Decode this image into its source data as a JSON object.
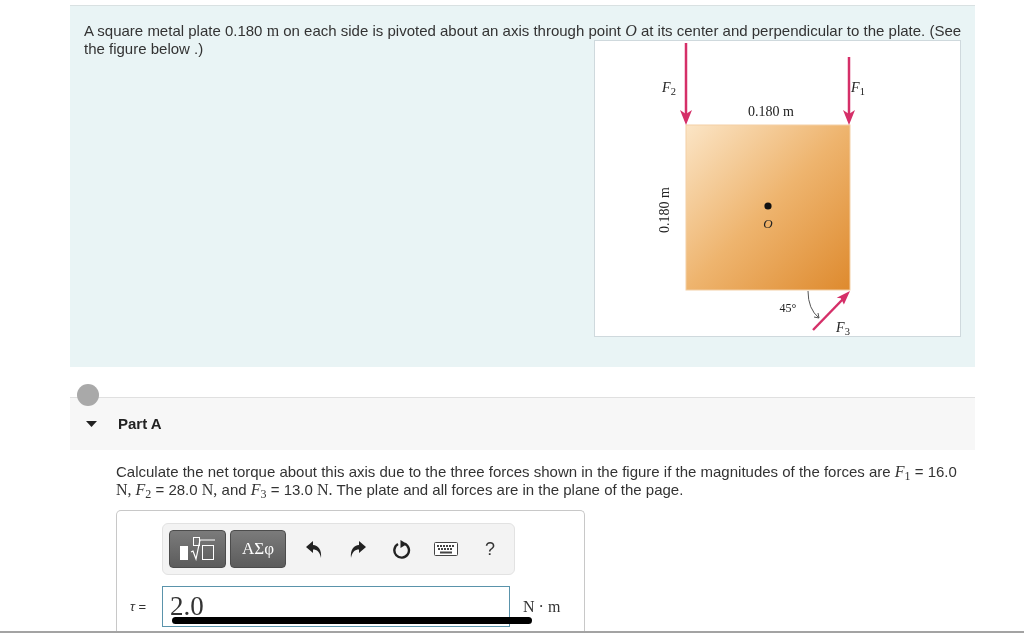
{
  "problem": {
    "intro": [
      {
        "kind": "text",
        "text": "A square metal plate 0.180 "
      },
      {
        "kind": "math",
        "text": "m"
      },
      {
        "kind": "text",
        "text": " on each side is pivoted about an axis through point "
      },
      {
        "kind": "math",
        "text": "*O*"
      },
      {
        "kind": "text",
        "text": " at its center and perpendicular to the plate. (See the figure below .)"
      }
    ]
  },
  "figure": {
    "forces": [
      {
        "label": "*F*$_{2}$"
      },
      {
        "label": "*F*$_{1}$"
      },
      {
        "label": "*F*$_{3}$"
      }
    ],
    "top_dimension": "0.180 m",
    "side_dimension": "0.180 m",
    "pivot_label": "O",
    "angle_label": "45°"
  },
  "part": {
    "title": "Part A",
    "expanded": true,
    "question": [
      {
        "kind": "text",
        "text": "Calculate the net torque about this axis due to the three forces shown in the figure if the magnitudes of the forces are "
      },
      {
        "kind": "math",
        "text": "*F*$_{1}$"
      },
      {
        "kind": "text",
        "text": " = 16.0 "
      },
      {
        "kind": "math",
        "text": "N, *F*$_{2}$"
      },
      {
        "kind": "text",
        "text": " = 28.0 "
      },
      {
        "kind": "math",
        "text": "N,"
      },
      {
        "kind": "text",
        "text": " and "
      },
      {
        "kind": "math",
        "text": "*F*$_{3}$"
      },
      {
        "kind": "text",
        "text": " = 13.0 "
      },
      {
        "kind": "math",
        "text": "N."
      },
      {
        "kind": "text",
        "text": " The plate and all forces are in the plane of the page."
      }
    ]
  },
  "answer": {
    "toolbar": {
      "symbols_label": "ΑΣφ",
      "help_label": "?"
    },
    "variable_label": "*τ* =",
    "value": "2.0",
    "units": "N · m"
  }
}
